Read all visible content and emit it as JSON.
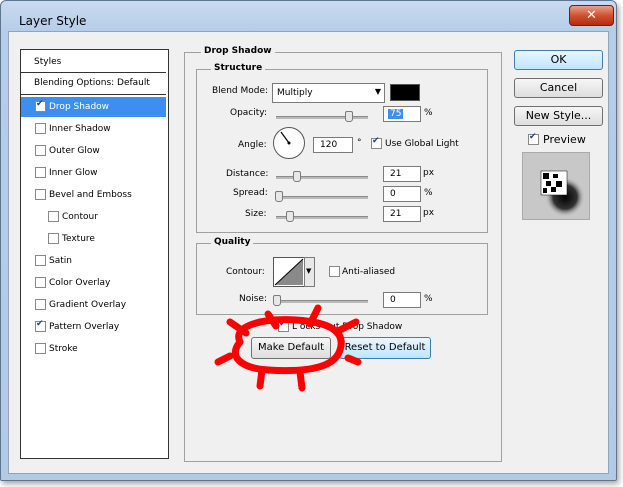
{
  "window": {
    "title": "Layer Style",
    "close_glyph": "✕"
  },
  "styles_panel": {
    "header": "Styles",
    "blending_options": "Blending Options: Default",
    "items": [
      {
        "label": "Drop Shadow",
        "checked": true,
        "selected": true
      },
      {
        "label": "Inner Shadow",
        "checked": false
      },
      {
        "label": "Outer Glow",
        "checked": false
      },
      {
        "label": "Inner Glow",
        "checked": false
      },
      {
        "label": "Bevel and Emboss",
        "checked": false
      },
      {
        "label": "Contour",
        "checked": false,
        "sub": true
      },
      {
        "label": "Texture",
        "checked": false,
        "sub": true
      },
      {
        "label": "Satin",
        "checked": false
      },
      {
        "label": "Color Overlay",
        "checked": false
      },
      {
        "label": "Gradient Overlay",
        "checked": false
      },
      {
        "label": "Pattern Overlay",
        "checked": true
      },
      {
        "label": "Stroke",
        "checked": false
      }
    ]
  },
  "drop_shadow": {
    "title": "Drop Shadow",
    "structure": {
      "title": "Structure",
      "blend_mode_label": "Blend Mode:",
      "blend_mode_value": "Multiply",
      "shadow_color": "#000000",
      "opacity_label": "Opacity:",
      "opacity_value": "75",
      "opacity_unit": "%",
      "angle_label": "Angle:",
      "angle_value": "120",
      "angle_unit": "°",
      "use_global_light_label": "Use Global Light",
      "distance_label": "Distance:",
      "distance_value": "21",
      "distance_unit": "px",
      "spread_label": "Spread:",
      "spread_value": "0",
      "spread_unit": "%",
      "size_label": "Size:",
      "size_value": "21",
      "size_unit": "px"
    },
    "quality": {
      "title": "Quality",
      "contour_label": "Contour:",
      "anti_aliased_label": "Anti-aliased",
      "noise_label": "Noise:",
      "noise_value": "0",
      "noise_unit": "%"
    },
    "knocks_out_label": "L       ocks Out Drop Shadow",
    "make_default_label": "Make Default",
    "reset_default_label": "Reset to Default"
  },
  "right_buttons": {
    "ok": "OK",
    "cancel": "Cancel",
    "new_style": "New Style...",
    "preview_label": "Preview"
  },
  "annotation_color": "#ff0000"
}
